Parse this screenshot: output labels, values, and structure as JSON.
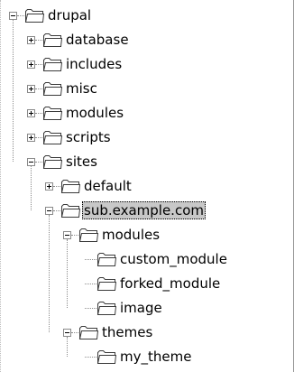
{
  "tree": {
    "root": {
      "id": "drupal",
      "label": "drupal",
      "expanded": true
    },
    "nodes": [
      {
        "id": "database",
        "label": "database",
        "expanded": false
      },
      {
        "id": "includes",
        "label": "includes",
        "expanded": false
      },
      {
        "id": "misc",
        "label": "misc",
        "expanded": false
      },
      {
        "id": "modules",
        "label": "modules",
        "expanded": false
      },
      {
        "id": "scripts",
        "label": "scripts",
        "expanded": false
      },
      {
        "id": "sites",
        "label": "sites",
        "expanded": true
      },
      {
        "id": "default",
        "label": "default",
        "expanded": false
      },
      {
        "id": "sub-example-com",
        "label": "sub.example.com",
        "expanded": true,
        "selected": true
      },
      {
        "id": "sub-modules",
        "label": "modules",
        "expanded": true
      },
      {
        "id": "custom-module",
        "label": "custom_module"
      },
      {
        "id": "forked-module",
        "label": "forked_module"
      },
      {
        "id": "image",
        "label": "image"
      },
      {
        "id": "themes",
        "label": "themes",
        "expanded": true
      },
      {
        "id": "my-theme",
        "label": "my_theme"
      }
    ]
  },
  "colors": {
    "folder_fill": "#ffffff",
    "folder_stroke": "#3a3a3a",
    "selection": "#c8c8c8",
    "guide_line": "#8c8c8c"
  },
  "icons": {
    "folder": "folder-icon",
    "expand": "plus-icon",
    "collapse": "minus-icon"
  }
}
